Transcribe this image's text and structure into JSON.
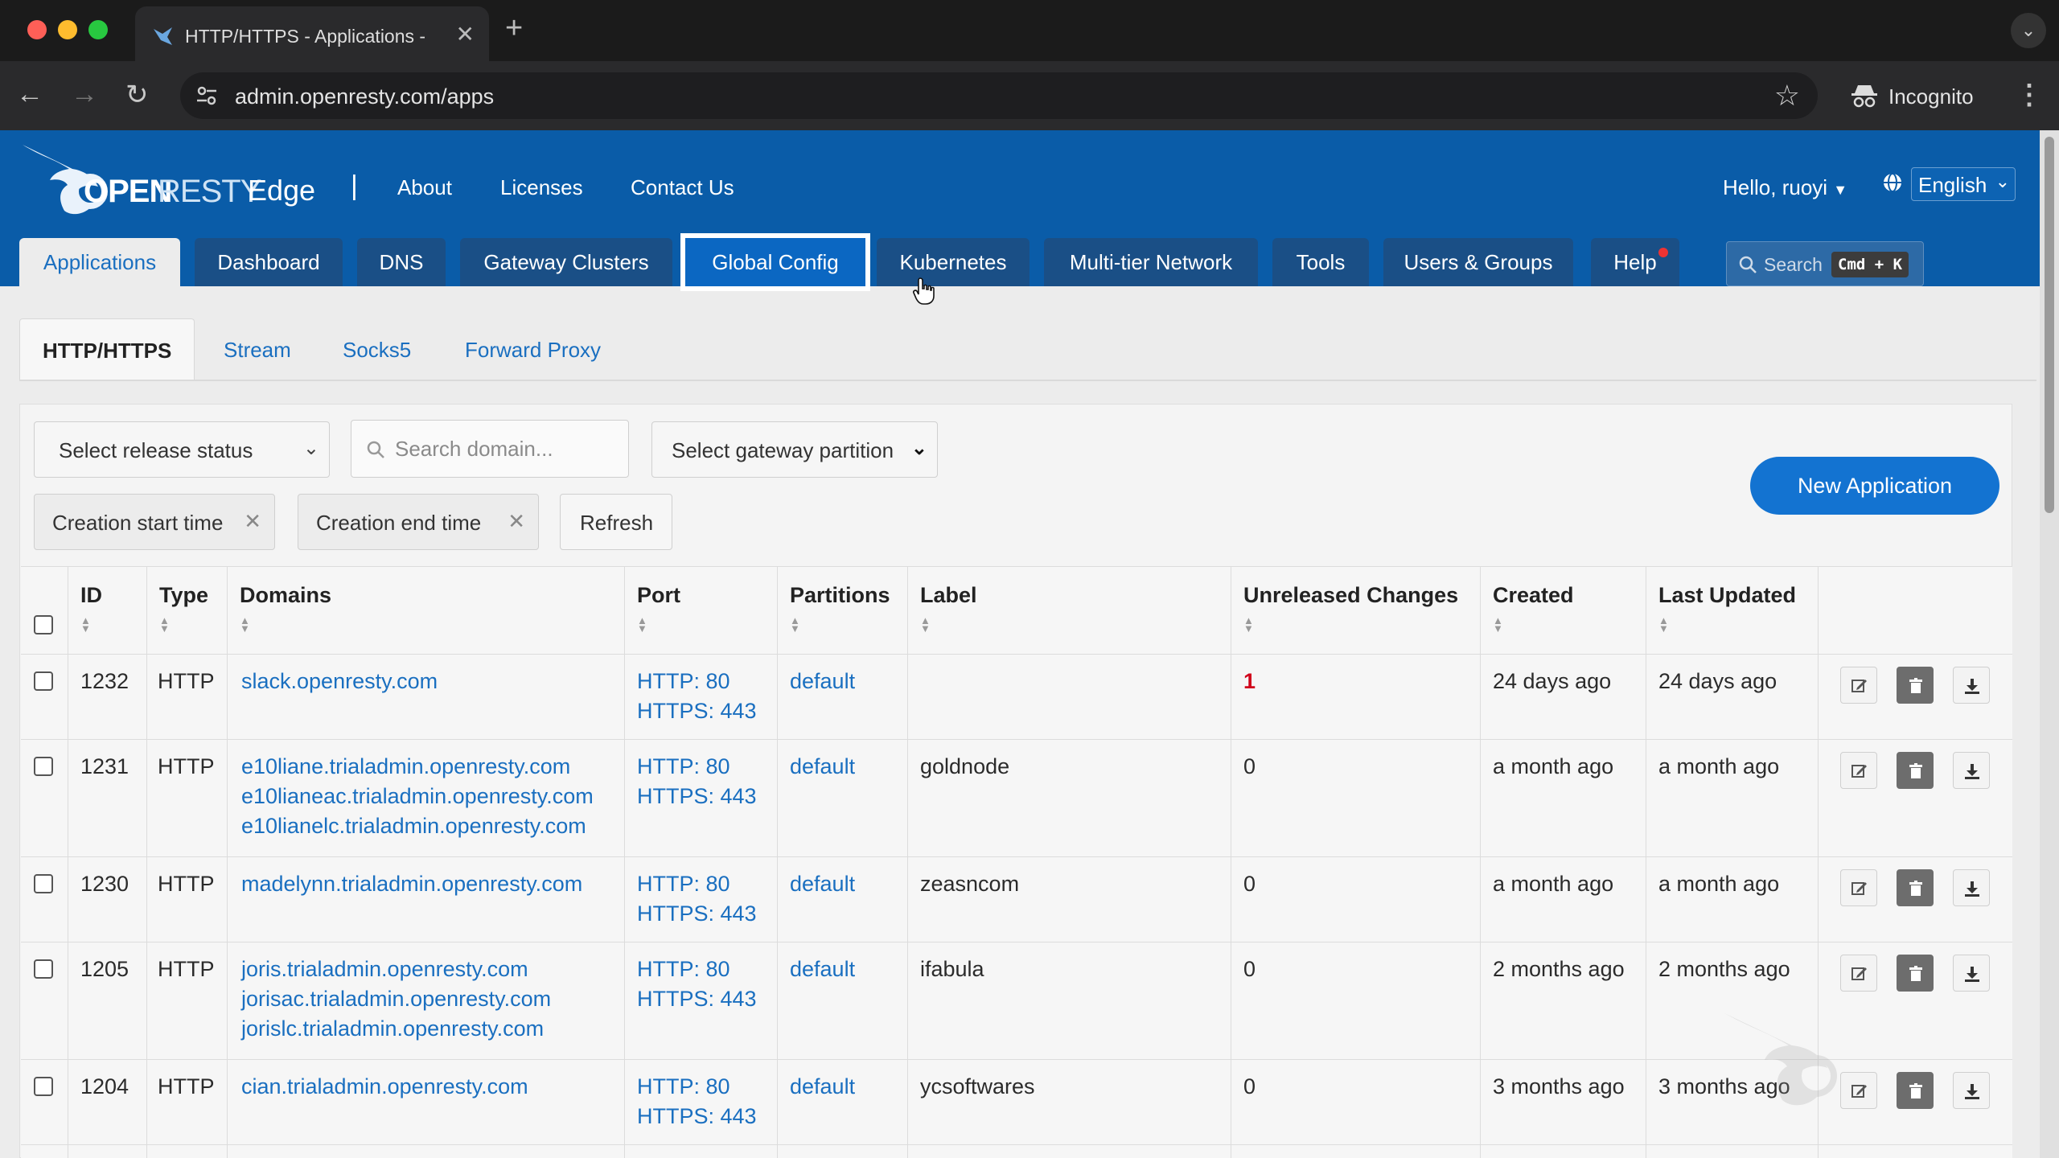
{
  "browser": {
    "tab_title": "HTTP/HTTPS - Applications -",
    "tab_close": "✕",
    "new_tab": "+",
    "url": "admin.openresty.com/apps",
    "incognito_label": "Incognito"
  },
  "header": {
    "logo_open": "OPEN",
    "logo_resty": "RESTY",
    "logo_edge": "Edge",
    "separator": "|",
    "links": [
      "About",
      "Licenses",
      "Contact Us"
    ],
    "user_greeting": "Hello, ruoyi",
    "language": "English"
  },
  "main_tabs": [
    "Applications",
    "Dashboard",
    "DNS",
    "Gateway Clusters",
    "Global Config",
    "Kubernetes",
    "Multi-tier Network",
    "Tools",
    "Users & Groups",
    "Help"
  ],
  "search": {
    "label": "Search",
    "shortcut": "Cmd + K"
  },
  "sub_tabs": [
    "HTTP/HTTPS",
    "Stream",
    "Socks5",
    "Forward Proxy"
  ],
  "filters": {
    "release_status": "Select release status",
    "domain_placeholder": "Search domain...",
    "gateway_partition": "Select gateway partition",
    "creation_start": "Creation start time",
    "creation_end": "Creation end time",
    "refresh": "Refresh",
    "new_application": "New Application"
  },
  "table": {
    "columns": [
      "ID",
      "Type",
      "Domains",
      "Port",
      "Partitions",
      "Label",
      "Unreleased Changes",
      "Created",
      "Last Updated"
    ],
    "rows": [
      {
        "id": "1232",
        "type": "HTTP",
        "domains": [
          "slack.openresty.com"
        ],
        "ports": [
          "HTTP:  80",
          "HTTPS:  443"
        ],
        "partition": "default",
        "label": "",
        "unreleased": "1",
        "created": "24 days ago",
        "updated": "24 days ago"
      },
      {
        "id": "1231",
        "type": "HTTP",
        "domains": [
          "e10liane.trialadmin.openresty.com",
          "e10lianeac.trialadmin.openresty.com",
          "e10lianelc.trialadmin.openresty.com"
        ],
        "ports": [
          "HTTP:  80",
          "HTTPS:  443"
        ],
        "partition": "default",
        "label": "goldnode",
        "unreleased": "0",
        "created": "a month ago",
        "updated": "a month ago"
      },
      {
        "id": "1230",
        "type": "HTTP",
        "domains": [
          "madelynn.trialadmin.openresty.com"
        ],
        "ports": [
          "HTTP:  80",
          "HTTPS:  443"
        ],
        "partition": "default",
        "label": "zeasncom",
        "unreleased": "0",
        "created": "a month ago",
        "updated": "a month ago"
      },
      {
        "id": "1205",
        "type": "HTTP",
        "domains": [
          "joris.trialadmin.openresty.com",
          "jorisac.trialadmin.openresty.com",
          "jorislc.trialadmin.openresty.com"
        ],
        "ports": [
          "HTTP:  80",
          "HTTPS:  443"
        ],
        "partition": "default",
        "label": "ifabula",
        "unreleased": "0",
        "created": "2 months ago",
        "updated": "2 months ago"
      },
      {
        "id": "1204",
        "type": "HTTP",
        "domains": [
          "cian.trialadmin.openresty.com"
        ],
        "ports": [
          "HTTP:  80",
          "HTTPS:  443"
        ],
        "partition": "default",
        "label": "ycsoftwares",
        "unreleased": "0",
        "created": "3 months ago",
        "updated": "3 months ago"
      }
    ]
  },
  "colors": {
    "brand_blue": "#0a5ca8",
    "link_blue": "#1a6fc0",
    "primary_button": "#1373d1",
    "unreleased_red": "#d0021b"
  }
}
